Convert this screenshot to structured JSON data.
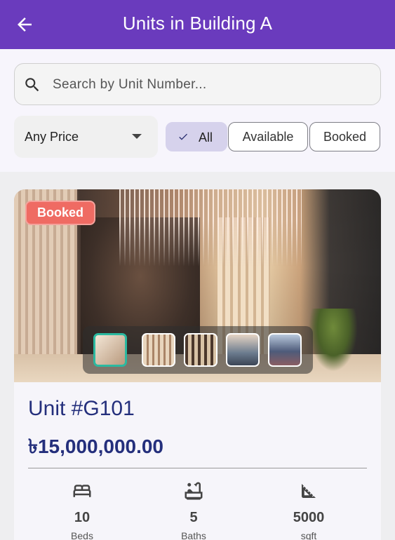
{
  "header": {
    "title": "Units in Building A",
    "back_icon": "arrow-left-icon"
  },
  "search": {
    "placeholder": "Search by Unit Number...",
    "value": ""
  },
  "price_filter": {
    "selected": "Any Price"
  },
  "status_filters": [
    {
      "label": "All",
      "selected": true
    },
    {
      "label": "Available",
      "selected": false
    },
    {
      "label": "Booked",
      "selected": false
    }
  ],
  "units": [
    {
      "status": "Booked",
      "title": "Unit #G101",
      "price": "৳15,000,000.00",
      "gallery": {
        "count": 5,
        "active_index": 0
      },
      "stats": {
        "beds": {
          "value": "10",
          "label": "Beds",
          "icon": "bed-icon"
        },
        "baths": {
          "value": "5",
          "label": "Baths",
          "icon": "bathtub-icon"
        },
        "sqft": {
          "value": "5000",
          "label": "sqft",
          "icon": "square-foot-icon"
        }
      }
    }
  ],
  "colors": {
    "app_bar": "#6a3bbd",
    "accent_text": "#242f7c",
    "booked_badge": "#ef6b63",
    "chip_selected": "#d6d2ec",
    "thumb_active": "#2bb9a0"
  }
}
